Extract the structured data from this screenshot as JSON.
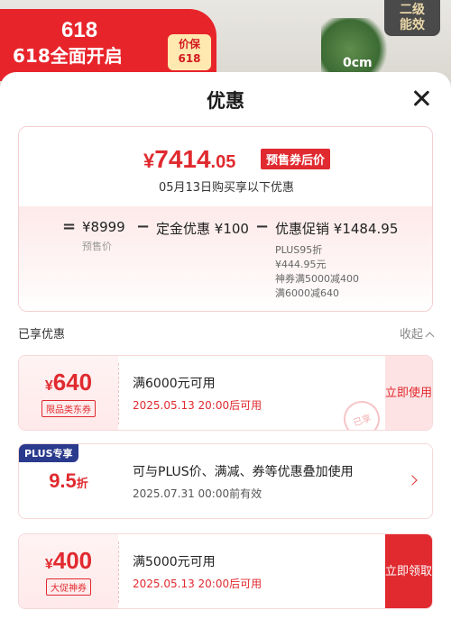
{
  "background": {
    "promo_number": "618",
    "promo_text": "618全面开启",
    "price_badge_line1": "价保",
    "price_badge_line2": "618",
    "tag_right_line1": "二级",
    "tag_right_line2": "能效",
    "size_label": "0cm"
  },
  "sheet": {
    "title": "优惠"
  },
  "price": {
    "symbol": "¥",
    "integer": "7414",
    "decimal": ".05",
    "tag": "预售券后价",
    "buy_date_text": "05月13日购买享以下优惠",
    "equals": "=",
    "minus1": "−",
    "minus2": "−",
    "presale_amount": "¥8999",
    "presale_label": "预售价",
    "deposit_label": "定金优惠",
    "deposit_amount": "¥100",
    "promo_label": "优惠促销",
    "promo_amount": "¥1484.95",
    "promo_detail_1": "PLUS95折",
    "promo_detail_2": "¥444.95元",
    "promo_detail_3": "神券满5000减400",
    "promo_detail_4": "满6000减640"
  },
  "section": {
    "label": "已享优惠",
    "collapse_label": "收起"
  },
  "coupons": [
    {
      "symbol": "¥",
      "amount": "640",
      "type": "限品类东券",
      "condition": "满6000元可用",
      "expire": "2025.05.13 20:00后可用",
      "action": "立即使用",
      "stamp": "已享"
    },
    {
      "symbol": "¥",
      "amount": "400",
      "type": "大促神券",
      "condition": "满5000元可用",
      "expire": "2025.05.13 20:00后可用",
      "action": "立即领取"
    }
  ],
  "plus": {
    "badge": "PLUS专享",
    "discount": "9.5",
    "unit": "折",
    "description": "可与PLUS价、满减、券等优惠叠加使用",
    "valid": "2025.07.31 00:00前有效"
  },
  "colors": {
    "accent_red": "#e02a2f",
    "plus_blue": "#2a3a8c"
  }
}
